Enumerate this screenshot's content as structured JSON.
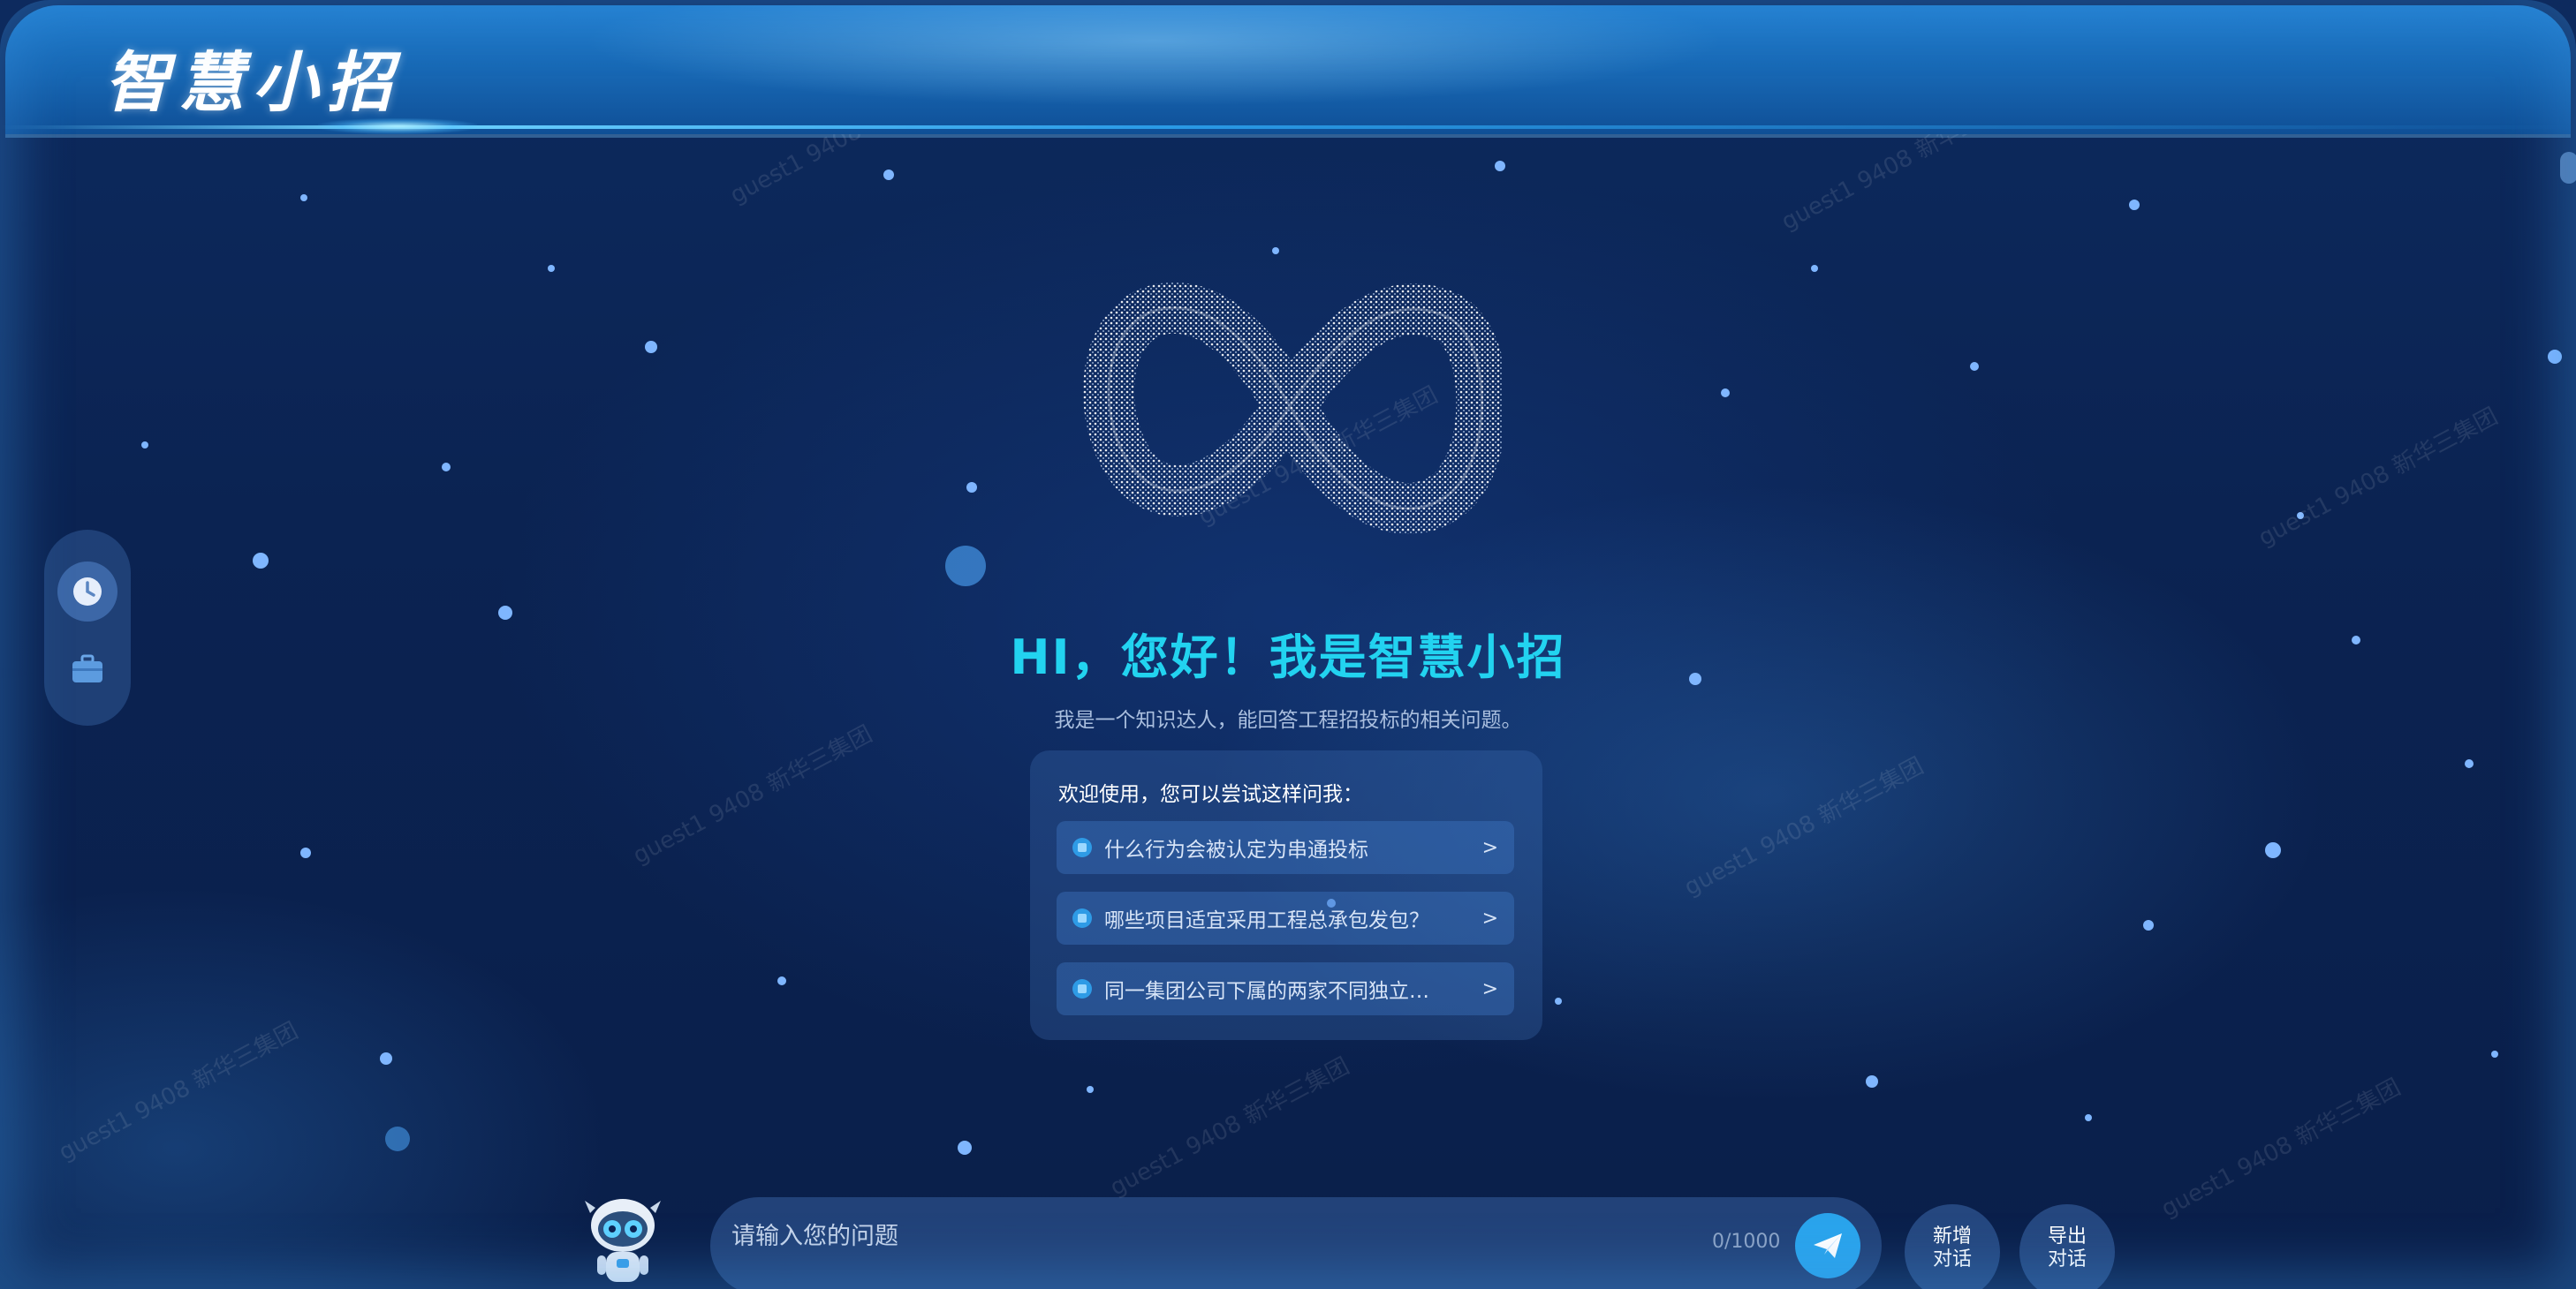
{
  "header": {
    "title": "智慧小招"
  },
  "side_tools": [
    {
      "name": "history",
      "icon": "clock-icon"
    },
    {
      "name": "toolbox",
      "icon": "briefcase-icon"
    }
  ],
  "hero": {
    "greeting": "HI，您好！我是智慧小招",
    "subtitle": "我是一个知识达人，能回答工程招投标的相关问题。"
  },
  "suggestions": {
    "title": "欢迎使用，您可以尝试这样问我：",
    "items": [
      {
        "label": "什么行为会被认定为串通投标",
        "arrow": ">"
      },
      {
        "label": "哪些项目适宜采用工程总承包发包？",
        "arrow": ">"
      },
      {
        "label": "同一集团公司下属的两家不同独立…",
        "arrow": ">"
      }
    ]
  },
  "input": {
    "placeholder": "请输入您的问题",
    "count": "0/1000"
  },
  "actions": {
    "new_chat": "新增对话",
    "export_chat": "导出对话"
  },
  "watermark": "guest1 9408 新华三集团",
  "colors": {
    "accent": "#22d3f0",
    "send": "#2aa4ec",
    "background": "#0b2352"
  }
}
